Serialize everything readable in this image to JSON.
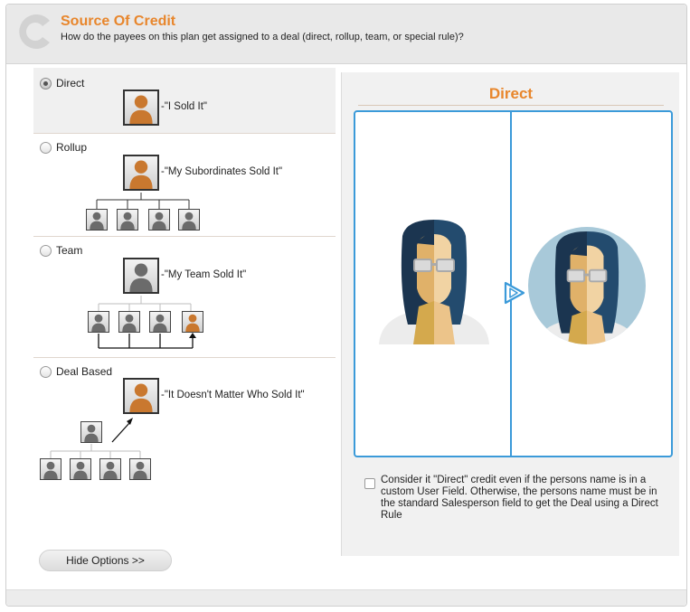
{
  "header": {
    "title": "Source Of Credit",
    "subtitle": "How do the payees on this plan get assigned to a deal (direct, rollup, team, or special rule)?",
    "logo_icon": "c-logo-icon"
  },
  "options": [
    {
      "label": "Direct",
      "caption": "-\"I Sold It\"",
      "selected": true
    },
    {
      "label": "Rollup",
      "caption": "-\"My Subordinates Sold It\"",
      "selected": false
    },
    {
      "label": "Team",
      "caption": "-\"My Team Sold It\"",
      "selected": false
    },
    {
      "label": "Deal Based",
      "caption": "-\"It Doesn't Matter Who Sold It\"",
      "selected": false
    }
  ],
  "hide_options_label": "Hide Options >>",
  "preview": {
    "title": "Direct",
    "checkbox_label": "Consider it \"Direct\" credit even if the persons name is in a custom User Field. Otherwise, the persons name must be in the standard Salesperson field to get the Deal using a Direct Rule",
    "checkbox_checked": false
  },
  "colors": {
    "accent": "#e8862c",
    "person_orange": "#c9782f",
    "person_gray": "#6b6b6b",
    "frame_blue": "#3b9ad9"
  }
}
